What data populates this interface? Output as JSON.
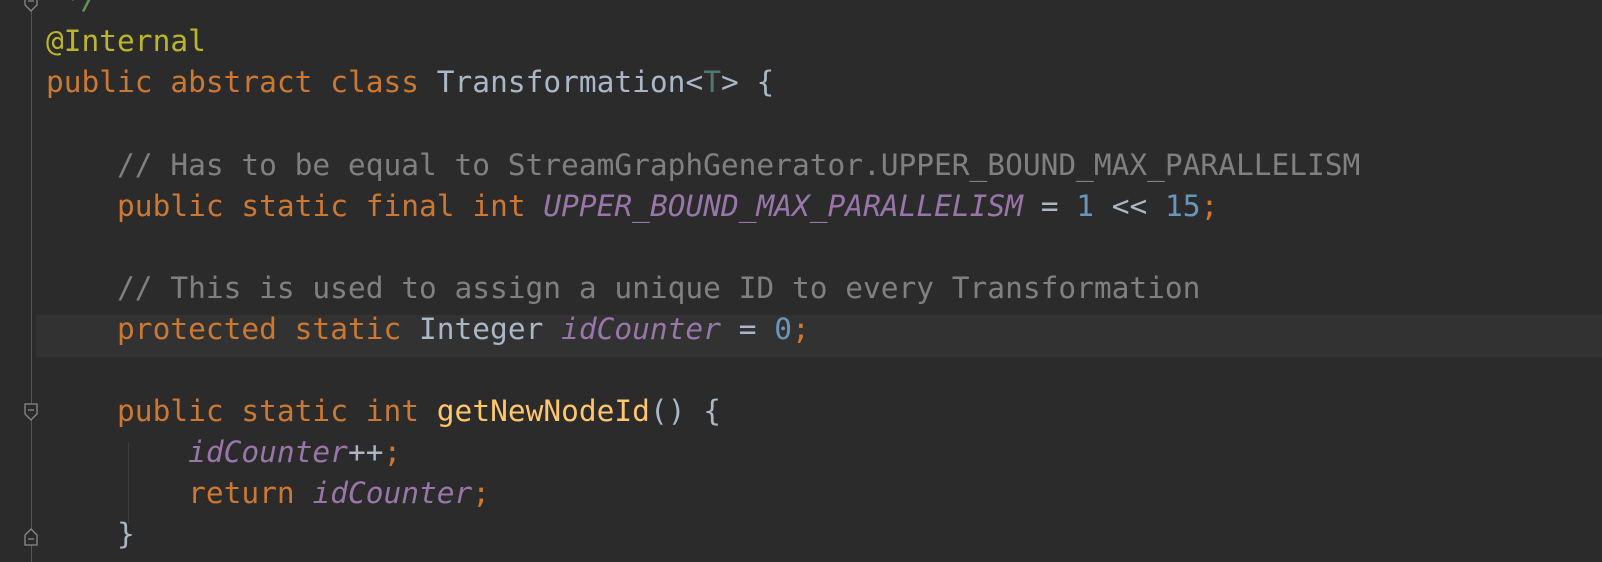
{
  "editor": {
    "theme_colors": {
      "background": "#2b2b2b",
      "keyword": "#cc7832",
      "annotation": "#bbb529",
      "comment": "#808080",
      "field": "#9876aa",
      "number": "#6897bb",
      "method": "#ffc66d",
      "plain": "#a9b7c6",
      "type_param": "#507874",
      "doc_comment": "#629755"
    },
    "lines": {
      "l0": {
        "doc_end": " */"
      },
      "l1": {
        "annotation": "@Internal"
      },
      "l2": {
        "kw1": "public",
        "kw2": "abstract",
        "kw3": "class",
        "name": "Transformation",
        "lt": "<",
        "tparam": "T",
        "rest": "> {"
      },
      "l4": {
        "comment": "// Has to be equal to StreamGraphGenerator.UPPER_BOUND_MAX_PARALLELISM"
      },
      "l5": {
        "kw1": "public",
        "kw2": "static",
        "kw3": "final",
        "kw4": "int",
        "field": "UPPER_BOUND_MAX_PARALLELISM",
        "eq": "=",
        "n1": "1",
        "op": "<<",
        "n2": "15",
        "semi": ";"
      },
      "l7": {
        "comment": "// This is used to assign a unique ID to every Transformation"
      },
      "l8": {
        "kw1": "protected",
        "kw2": "static",
        "type": "Integer",
        "field": "idCounter",
        "eq": "=",
        "n1": "0",
        "semi": ";"
      },
      "l10": {
        "kw1": "public",
        "kw2": "static",
        "kw3": "int",
        "method": "getNewNodeId",
        "rest": "() {"
      },
      "l11": {
        "field": "idCounter",
        "op": "++",
        "semi": ";"
      },
      "l12": {
        "kw": "return",
        "field": "idCounter",
        "semi": ";"
      },
      "l13": {
        "brace": "}"
      }
    }
  }
}
